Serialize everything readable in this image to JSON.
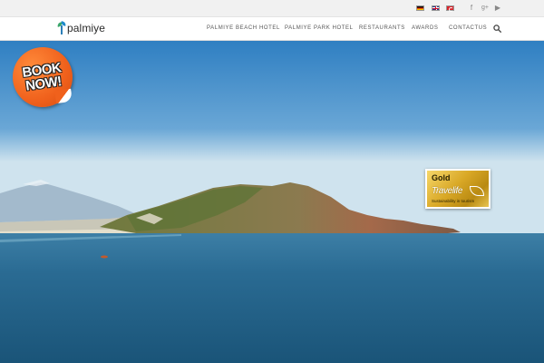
{
  "topbar": {
    "languages": [
      {
        "name": "german-flag-icon"
      },
      {
        "name": "english-flag-icon"
      },
      {
        "name": "turkish-flag-icon"
      }
    ],
    "social": {
      "facebook": "f",
      "googleplus": "g+",
      "youtube": "▶"
    }
  },
  "header": {
    "logo_text": "palmiye",
    "nav": [
      {
        "label": "PALMIYE BEACH HOTEL"
      },
      {
        "label": "PALMIYE PARK HOTEL"
      },
      {
        "label": "RESTAURANTS"
      },
      {
        "label": "AWARDS"
      },
      {
        "label": "CONTACTUS"
      }
    ],
    "search_icon": "search-icon"
  },
  "hero": {
    "book_now": {
      "line1": "BOOK",
      "line2": "NOW!"
    },
    "badge": {
      "tier": "Gold",
      "brand": "Travelife",
      "subtitle": "Sustainability in tourism"
    }
  },
  "colors": {
    "sky_top": "#2f7fc2",
    "sky_bottom": "#cfe3ee",
    "sea": "#1f5f86",
    "book_now": "#f0611c",
    "badge_gold": "#d9a826"
  }
}
